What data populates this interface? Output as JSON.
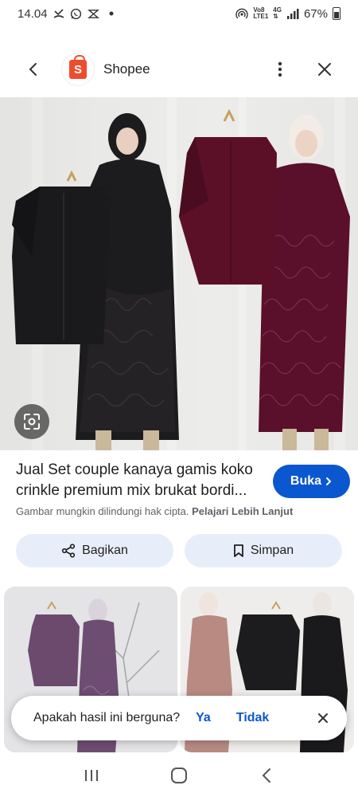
{
  "status_bar": {
    "time": "14.04",
    "network_top": "Vo8",
    "network_bottom": "LTE1",
    "network_type": "4G",
    "battery": "67%"
  },
  "header": {
    "site_name": "Shopee",
    "logo_letter": "S"
  },
  "result": {
    "title": "Jual Set couple kanaya gamis koko crinkle premium mix brukat bordi...",
    "visit_label": "Buka",
    "copyright_text": "Gambar mungkin dilindungi hak cipta.",
    "learn_more": "Pelajari Lebih Lanjut",
    "share_label": "Bagikan",
    "save_label": "Simpan"
  },
  "feedback": {
    "question": "Apakah hasil ini berguna?",
    "yes": "Ya",
    "no": "Tidak"
  },
  "colors": {
    "accent": "#0b57d0",
    "shopee": "#ee4d2d",
    "pill_bg": "#e8eef9",
    "maroon": "#5a0f2a",
    "black_outfit": "#1c1c1e"
  }
}
